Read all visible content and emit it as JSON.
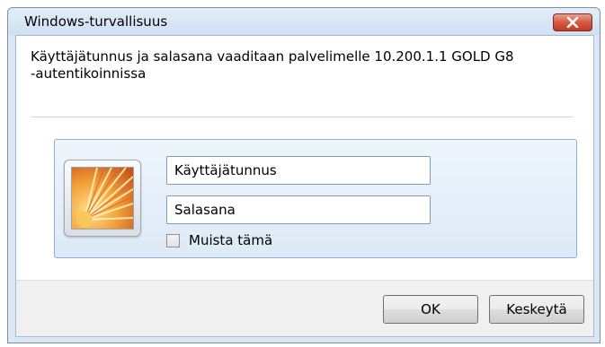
{
  "window": {
    "title": "Windows-turvallisuus",
    "close_icon": "close-icon",
    "close_color": "#c8412a"
  },
  "message": {
    "line1": "Käyttäjätunnus ja salasana vaaditaan palvelimelle 10.200.1.1 GOLD G8",
    "line2": "-autentikoinnissa"
  },
  "credentials": {
    "avatar_icon": "user-avatar-flower-icon",
    "username_placeholder": "Käyttäjätunnus",
    "password_placeholder": "Salasana",
    "remember_label": "Muista tämä",
    "remember_checked": false
  },
  "buttons": {
    "ok_label": "OK",
    "cancel_label": "Keskeytä"
  }
}
